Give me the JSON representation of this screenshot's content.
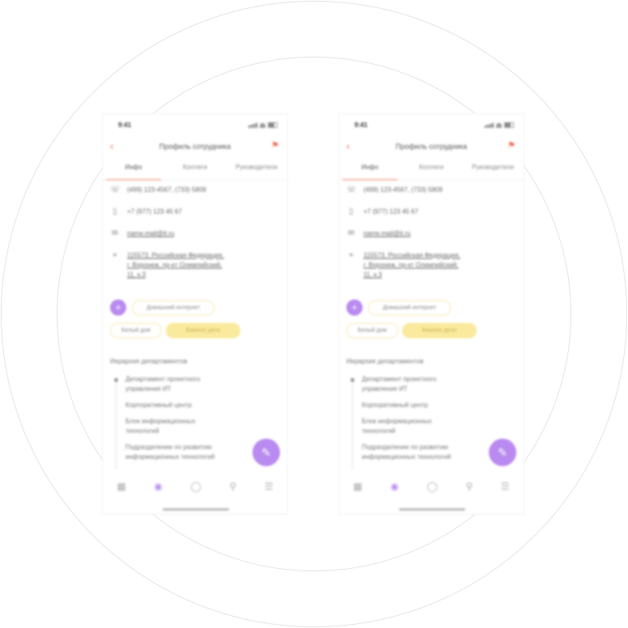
{
  "screens": [
    {
      "status": {
        "time": "9:41"
      },
      "header": {
        "title": "Профиль сотрудника",
        "back_icon": "chevron-left-icon",
        "action_icon": "flag-icon"
      },
      "tabs": [
        "Инфо",
        "Коллеги",
        "Руководители"
      ],
      "contacts": {
        "phone": "(499) 123-4567, (733) 5809",
        "mobile": "+7 (977) 123 45 67",
        "email": "name.mail@it.ru",
        "address_line1": "115573, Российская Федерация,",
        "address_line2": "г. Воронеж, пр-кт Олимпийский,",
        "address_line3": "11, к.3"
      },
      "chips": {
        "first": "Домашний интернет",
        "second": "Белый дом",
        "third": "Важное дело"
      },
      "section_title": "Иерархия департаментов",
      "hierarchy": [
        {
          "l1": "Департамент проектного",
          "l2": "управления ИТ"
        },
        {
          "l1": "Корпоративный центр",
          "l2": ""
        },
        {
          "l1": "Блок информационных",
          "l2": "технологий"
        },
        {
          "l1": "Подразделение по развитию",
          "l2": "информационных технологий"
        }
      ],
      "fab_icon": "pencil-icon",
      "nav_icons": [
        "calendar-icon",
        "profile-icon",
        "chat-icon",
        "search-icon",
        "menu-icon"
      ]
    },
    {
      "status": {
        "time": "9:41"
      },
      "header": {
        "title": "Профиль сотрудника",
        "back_icon": "chevron-left-icon",
        "action_icon": "flag-icon"
      },
      "tabs": [
        "Инфо",
        "Коллеги",
        "Руководители"
      ],
      "contacts": {
        "phone": "(499) 123-4567, (733) 5809",
        "mobile": "+7 (977) 123 45 67",
        "email": "name.mail@it.ru",
        "address_line1": "115573, Российская Федерация,",
        "address_line2": "г. Воронеж, пр-кт Олимпийский,",
        "address_line3": "11, к.3"
      },
      "chips": {
        "first": "Домашний интернет",
        "second": "Белый дом",
        "third": "Важное дело"
      },
      "section_title": "Иерархия департаментов",
      "hierarchy": [
        {
          "l1": "Департамент проектного",
          "l2": "управления ИТ"
        },
        {
          "l1": "Корпоративный центр",
          "l2": ""
        },
        {
          "l1": "Блок информационных",
          "l2": "технологий"
        },
        {
          "l1": "Подразделение по развитию",
          "l2": "информационных технологий"
        }
      ],
      "fab_icon": "pencil-icon",
      "nav_icons": [
        "calendar-icon",
        "profile-icon",
        "chat-icon",
        "search-icon",
        "menu-icon"
      ]
    }
  ],
  "colors": {
    "accent": "#f06a4f",
    "purple": "#b98af0",
    "chip_yellow": "#faea9d"
  }
}
